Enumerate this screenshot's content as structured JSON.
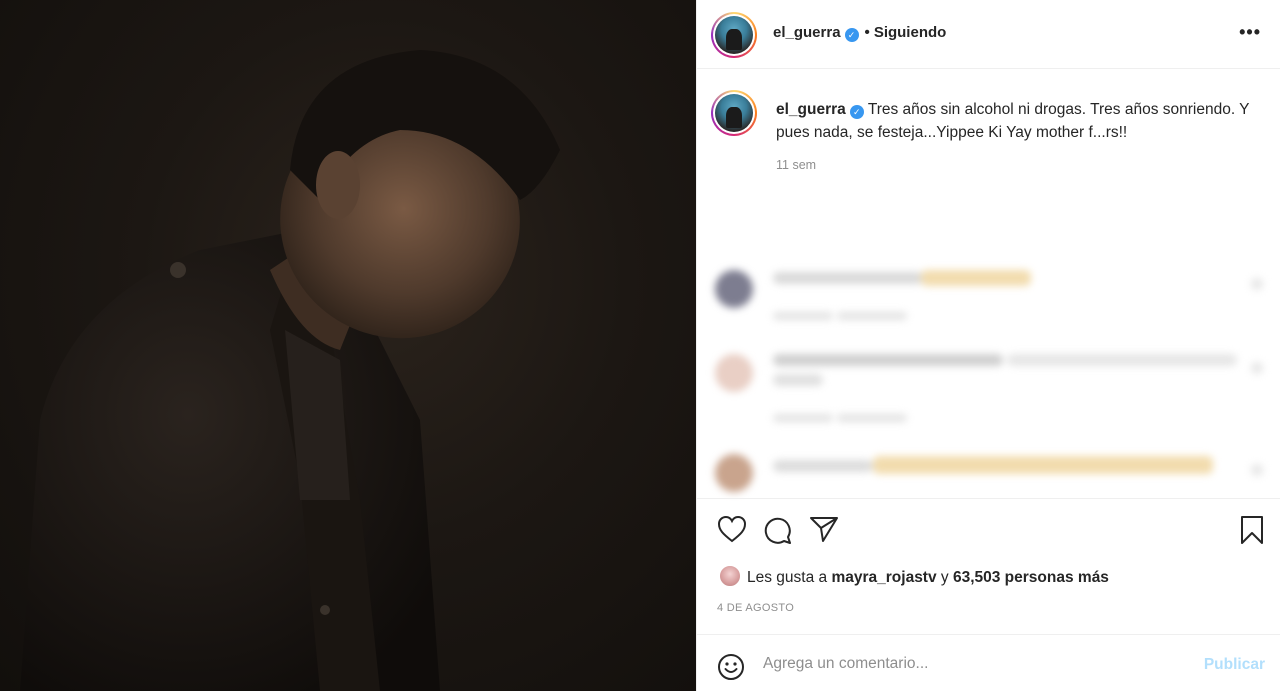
{
  "photo": {
    "alt_icon": "man-in-dark-coat-photo"
  },
  "header": {
    "username": "el_guerra",
    "verified_mark": "✓",
    "separator": "•",
    "follow_status": "Siguiendo",
    "more_label": "•••"
  },
  "caption": {
    "username": "el_guerra",
    "text": "Tres años sin alcohol ni drogas. Tres años sonriendo. Y pues nada, se festeja...Yippee Ki Yay mother f...rs!!",
    "time_ago": "11 sem"
  },
  "actions": {
    "like": "heart-icon",
    "comment": "comment-icon",
    "share": "send-icon",
    "save": "bookmark-icon"
  },
  "likes": {
    "prefix": "Les gusta a",
    "liked_by": "mayra_rojastv",
    "connector": "y",
    "others": "63,503 personas más"
  },
  "post_date": "4 DE AGOSTO",
  "comment_box": {
    "placeholder": "Agrega un comentario...",
    "publish_label": "Publicar"
  },
  "colors": {
    "accent": "#3897f0",
    "publish_disabled": "#b2dffc",
    "secondary_text": "#8e8e8e",
    "border": "#efefef"
  }
}
